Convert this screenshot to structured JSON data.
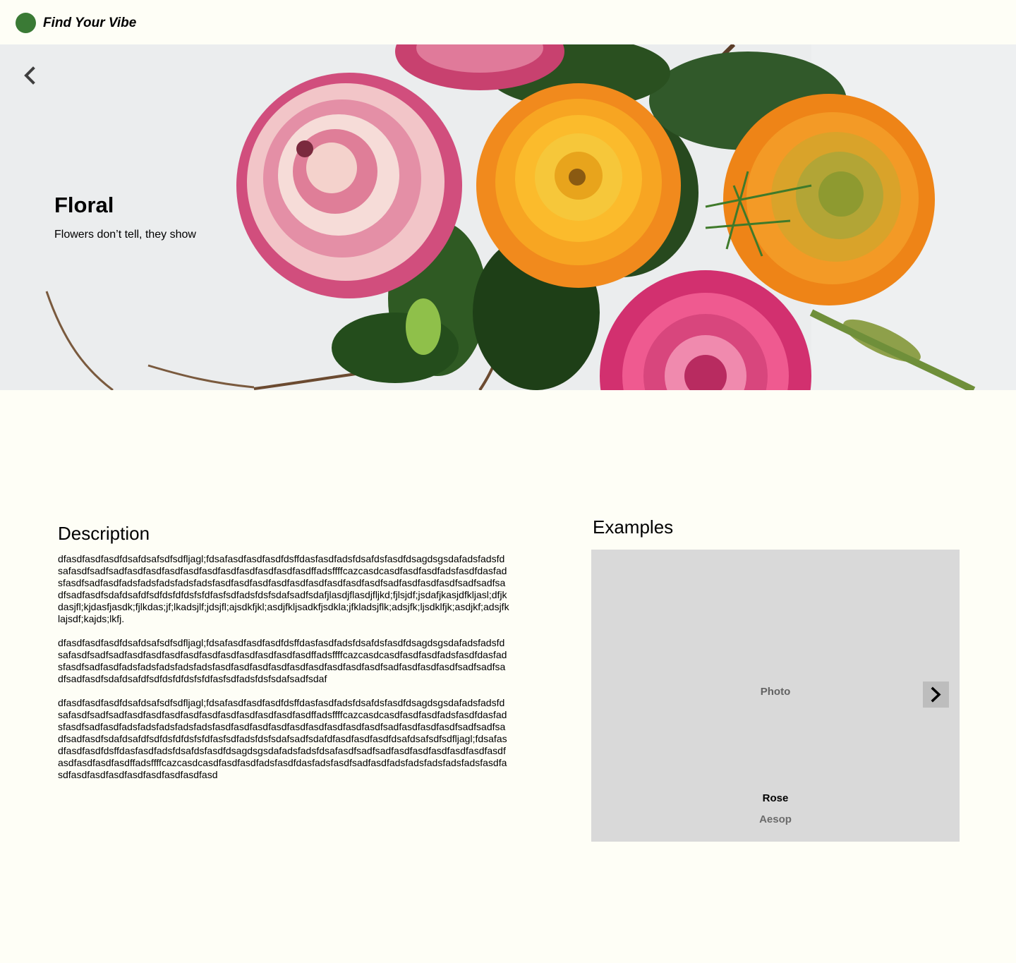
{
  "app": {
    "brand": "Find Your Vibe",
    "logo_color": "#3a7a35"
  },
  "hero": {
    "title": "Floral",
    "tagline": "Flowers don’t tell, they show",
    "back_icon": "chevron-left-icon"
  },
  "description": {
    "heading": "Description",
    "paragraphs": [
      "dfasdfasdfasdfdsafdsafsdfsdfljagl;fdsafasdfasdfasdfdsffdasfasdfadsfdsafdsfasdfdsagdsgsdafadsfadsfdsafasdfsadfsadfasdfasdfasdfasdfasdfasdfasdfasdfasdfasdffadsffffcazcasdcasdfasdfasdfadsfasdfdasfadsfasdfsadfasdfadsfadsfadsfadsfadsfasdfasdfasdfasdfasdfasdfasdfasdfasdfsadfasdfasdfasdfsadfsadfsadfsadfasdfsdafdsafdfsdfdsfdfdsfsfdfasfsdfadsfdsfsdafsadfsdafjlasdjflasdjfljkd;fjlsjdf;jsdafjkasjdfkljasl;dfjkdasjfl;kjdasfjasdk;fjlkdas;jf;lkadsjlf;jdsjfl;ajsdkfjkl;asdjfkljsadkfjsdkla;jfkladsjflk;adsjfk;ljsdklfjk;asdjkf;adsjfklajsdf;kajds;lkfj.",
      "dfasdfasdfasdfdsafdsafsdfsdfljagl;fdsafasdfasdfasdfdsffdasfasdfadsfdsafdsfasdfdsagdsgsdafadsfadsfdsafasdfsadfsadfasdfasdfasdfasdfasdfasdfasdfasdfasdfasdffadsffffcazcasdcasdfasdfasdfadsfasdfdasfadsfasdfsadfasdfadsfadsfadsfadsfadsfasdfasdfasdfasdfasdfasdfasdfasdfasdfsadfasdfasdfasdfsadfsadfsadfsadfasdfsdafdsafdfsdfdsfdfdsfsfdfasfsdfadsfdsfsdafsadfsdaf",
      "dfasdfasdfasdfdsafdsafsdfsdfljagl;fdsafasdfasdfasdfdsffdasfasdfadsfdsafdsfasdfdsagdsgsdafadsfadsfdsafasdfsadfsadfasdfasdfasdfasdfasdfasdfasdfasdfasdfasdffadsffffcazcasdcasdfasdfasdfadsfasdfdasfadsfasdfsadfasdfadsfadsfadsfadsfadsfasdfasdfasdfasdfasdfasdfasdfasdfasdfsadfasdfasdfasdfsadfsadfsadfsadfasdfsdafdsafdfsdfdsfdfdsfsfdfasfsdfadsfdsfsdafsadfsdafdfasdfasdfasdfdsafdsafsdfsdfljagl;fdsafasdfasdfasdfdsffdasfasdfadsfdsafdsfasdfdsagdsgsdafadsfadsfdsafasdfsadfsadfasdfasdfasdfasdfasdfasdfasdfasdfasdfasdffadsffffcazcasdcasdfasdfasdfadsfasdfdasfadsfasdfsadfasdfadsfadsfadsfadsfadsfasdfasdfasdfasdfasdfasdfasdfasdfasdfasd"
    ]
  },
  "examples": {
    "heading": "Examples",
    "photo_label": "Photo",
    "next_icon": "chevron-right-icon",
    "item_name": "Rose",
    "item_brand": "Aesop"
  }
}
